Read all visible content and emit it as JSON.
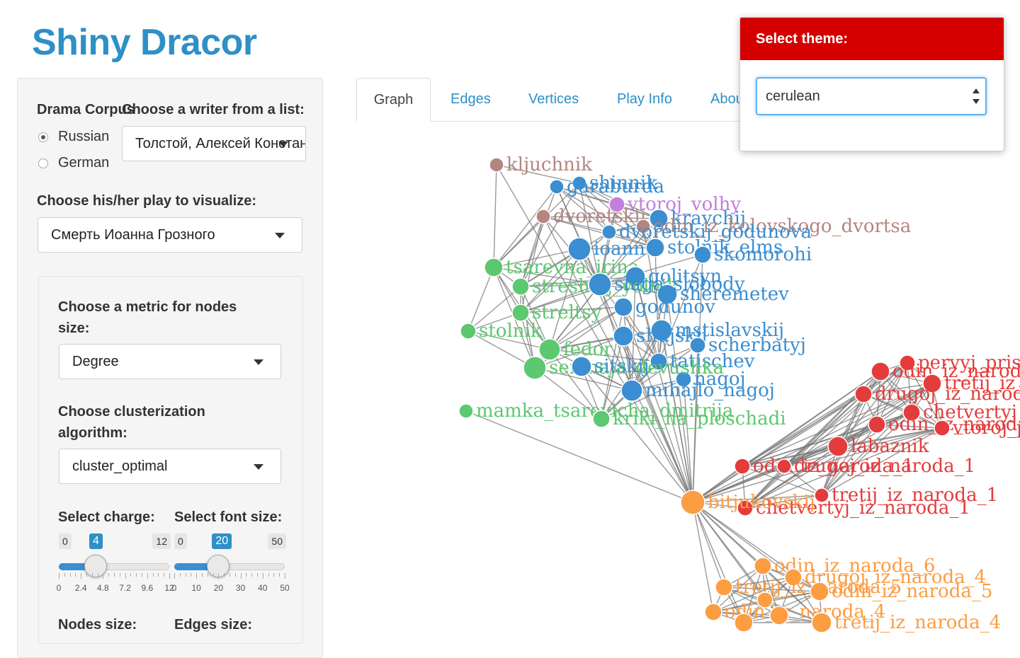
{
  "app": {
    "title": "Shiny Dracor"
  },
  "sidebar": {
    "corpus_label": "Drama Corpus",
    "corpus_options": [
      {
        "label": "Russian",
        "selected": true
      },
      {
        "label": "German",
        "selected": false
      }
    ],
    "writer_label": "Choose a writer from a list:",
    "writer_value": "Толстой, Алексей Константинович",
    "play_label": "Choose his/her play to visualize:",
    "play_value": "Смерть Иоанна Грозного",
    "metric_label": "Choose a metric for nodes size:",
    "metric_value": "Degree",
    "cluster_label": "Choose clusterization algorithm:",
    "cluster_value": "cluster_optimal",
    "charge": {
      "label": "Select charge:",
      "min": "0",
      "max": "12",
      "value": "4",
      "min_num": 0,
      "max_num": 12,
      "value_num": 4,
      "tick_labels": [
        "0",
        "2.4",
        "4.8",
        "7.2",
        "9.6",
        "12"
      ]
    },
    "font_size": {
      "label": "Select font size:",
      "min": "0",
      "max": "50",
      "value": "20",
      "min_num": 0,
      "max_num": 50,
      "value_num": 20,
      "tick_labels": [
        "0",
        "10",
        "20",
        "30",
        "40",
        "50"
      ]
    },
    "nodes_size_label": "Nodes size:",
    "edges_size_label": "Edges size:"
  },
  "tabs": [
    {
      "label": "Graph",
      "active": true
    },
    {
      "label": "Edges",
      "active": false
    },
    {
      "label": "Vertices",
      "active": false
    },
    {
      "label": "Play Info",
      "active": false
    },
    {
      "label": "About",
      "active": false
    }
  ],
  "theme": {
    "header": "Select theme:",
    "value": "cerulean",
    "header_color": "#d40000"
  },
  "graph": {
    "colors": {
      "green": "#5cc86f",
      "blue": "#3a8ed1",
      "brown": "#b58580",
      "purple": "#c27fdd",
      "red": "#e43c3c",
      "orange": "#fd9d42"
    },
    "hub": "bitjukovskij",
    "nodes": [
      {
        "label": "kljuchnik",
        "group": "brown"
      },
      {
        "label": "shinnik",
        "group": "blue"
      },
      {
        "label": "garaburda",
        "group": "blue"
      },
      {
        "label": "vtoroj_volhy",
        "group": "purple"
      },
      {
        "label": "dvoretskij",
        "group": "brown"
      },
      {
        "label": "kravchij",
        "group": "blue"
      },
      {
        "label": "odin_iz_kolovskogo_dvortsa",
        "group": "brown"
      },
      {
        "label": "dvoretskij_godunova",
        "group": "blue"
      },
      {
        "label": "ioann",
        "group": "blue"
      },
      {
        "label": "stolnik_elms",
        "group": "blue"
      },
      {
        "label": "skomorohi",
        "group": "blue"
      },
      {
        "label": "tsarevna_irina",
        "group": "green"
      },
      {
        "label": "golitsyn",
        "group": "blue"
      },
      {
        "label": "streshkij_yolnik",
        "group": "green"
      },
      {
        "label": "sheremetev",
        "group": "blue"
      },
      {
        "label": "sluga_slobody",
        "group": "blue"
      },
      {
        "label": "godunov",
        "group": "blue"
      },
      {
        "label": "streltsy",
        "group": "green"
      },
      {
        "label": "mstislavskij",
        "group": "blue"
      },
      {
        "label": "stolnik",
        "group": "green"
      },
      {
        "label": "shujskij",
        "group": "blue"
      },
      {
        "label": "fedor",
        "group": "green"
      },
      {
        "label": "scherbatyj",
        "group": "blue"
      },
      {
        "label": "tatischev",
        "group": "blue"
      },
      {
        "label": "nagoj",
        "group": "blue"
      },
      {
        "label": "semnaja_devushka",
        "group": "green"
      },
      {
        "label": "sitskij",
        "group": "blue"
      },
      {
        "label": "mihajlo_nagoj",
        "group": "blue"
      },
      {
        "label": "mamka_tsarevicha_dmitrija",
        "group": "green"
      },
      {
        "label": "kriki_na_ploschadi",
        "group": "green"
      },
      {
        "label": "pervyj_pristav",
        "group": "red"
      },
      {
        "label": "odin_iz_naroda",
        "group": "red"
      },
      {
        "label": "tretij_iz_naroda",
        "group": "red"
      },
      {
        "label": "drugoj_iz_naroda",
        "group": "red"
      },
      {
        "label": "chetvertyj",
        "group": "red"
      },
      {
        "label": "labaznik",
        "group": "red"
      },
      {
        "label": "odin_iz_naroda_2",
        "group": "red"
      },
      {
        "label": "vtoroj_pristav",
        "group": "red"
      },
      {
        "label": "odin_iz_naroda_1",
        "group": "red"
      },
      {
        "label": "drugoj_iz_naroda_1",
        "group": "red"
      },
      {
        "label": "tretij_iz_naroda_1",
        "group": "red"
      },
      {
        "label": "chetvertyj_iz_naroda_1",
        "group": "red"
      },
      {
        "label": "odin_iz_naroda_6",
        "group": "orange"
      },
      {
        "label": "drugoj_iz_naroda_4",
        "group": "orange"
      },
      {
        "label": "tretij_iz_naroda_5",
        "group": "orange"
      },
      {
        "label": "odin_iz_naroda_5",
        "group": "orange"
      },
      {
        "label": "odin_iz_naroda_4",
        "group": "orange"
      },
      {
        "label": "tretij_iz_naroda_4",
        "group": "orange"
      }
    ]
  }
}
